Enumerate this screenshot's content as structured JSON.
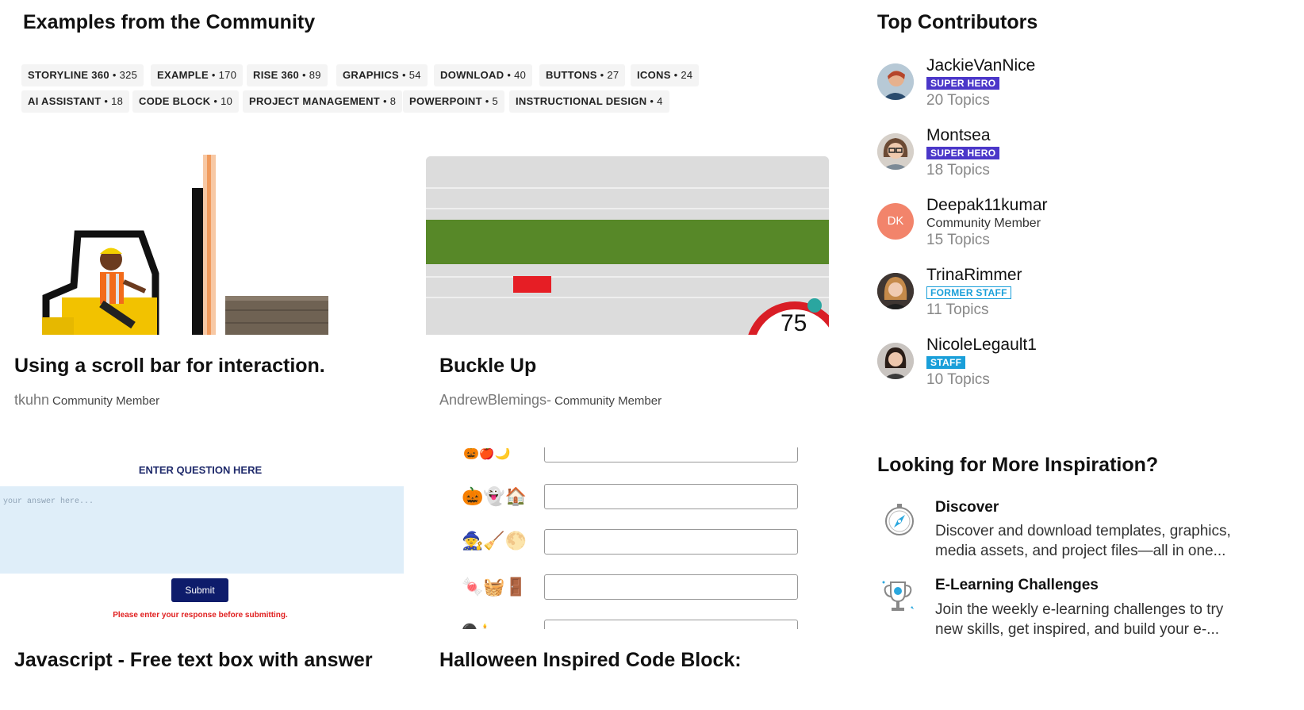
{
  "examples": {
    "title": "Examples from the Community",
    "tags": [
      {
        "label": "STORYLINE 360",
        "count": "325"
      },
      {
        "label": "EXAMPLE",
        "count": "170"
      },
      {
        "label": "RISE 360",
        "count": "89"
      },
      {
        "label": "GRAPHICS",
        "count": "54"
      },
      {
        "label": "DOWNLOAD",
        "count": "40"
      },
      {
        "label": "BUTTONS",
        "count": "27"
      },
      {
        "label": "ICONS",
        "count": "24"
      },
      {
        "label": "AI ASSISTANT",
        "count": "18"
      },
      {
        "label": "CODE BLOCK",
        "count": "10"
      },
      {
        "label": "PROJECT MANAGEMENT",
        "count": "8"
      },
      {
        "label": "POWERPOINT",
        "count": "5"
      },
      {
        "label": "INSTRUCTIONAL DESIGN",
        "count": "4"
      }
    ],
    "tag_separator": "•",
    "cards": [
      {
        "title": "Using a scroll bar for interaction.",
        "author": "tkuhn",
        "role": "Community Member"
      },
      {
        "title": "Buckle Up",
        "author": "AndrewBlemings-",
        "role": "Community Member",
        "speed": "75"
      },
      {
        "title": "Javascript - Free text box with answer",
        "question": "ENTER QUESTION HERE",
        "placeholder": "your answer here...",
        "submit": "Submit",
        "warning": "Please enter your response before submitting."
      },
      {
        "title": "Halloween Inspired Code Block:"
      }
    ]
  },
  "contributors": {
    "title": "Top Contributors",
    "items": [
      {
        "name": "JackieVanNice",
        "badge": "SUPER HERO",
        "topics": "20 Topics"
      },
      {
        "name": "Montsea",
        "badge": "SUPER HERO",
        "topics": "18 Topics"
      },
      {
        "name": "Deepak11kumar",
        "initials": "DK",
        "role": "Community Member",
        "topics": "15 Topics"
      },
      {
        "name": "TrinaRimmer",
        "badge": "FORMER STAFF",
        "topics": "11 Topics"
      },
      {
        "name": "NicoleLegault1",
        "badge": "STAFF",
        "topics": "10 Topics"
      }
    ]
  },
  "inspiration": {
    "title": "Looking for More Inspiration?",
    "items": [
      {
        "title": "Discover",
        "desc": "Discover and download templates, graphics, media assets, and project files—all in one..."
      },
      {
        "title": "E-Learning Challenges",
        "desc": "Join the weekly e-learning challenges to try new skills, get inspired, and build your e-..."
      }
    ]
  },
  "colors": {
    "hero_badge": "#4b37c9",
    "staff_badge": "#1a9fd9",
    "dk_avatar": "#f2846b"
  }
}
